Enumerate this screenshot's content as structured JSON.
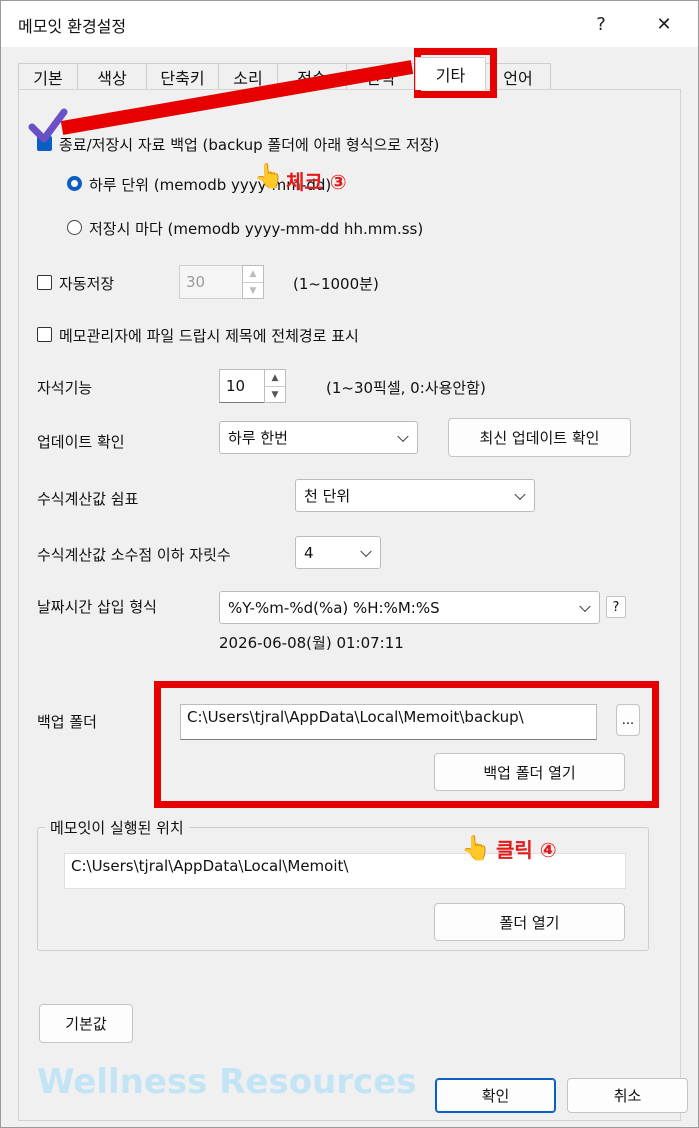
{
  "window": {
    "title": "메모잇 환경설정",
    "help_label": "?",
    "close_label": "✕"
  },
  "tabs": [
    "기본",
    "색상",
    "단축키",
    "소리",
    "전송",
    "단락",
    "기타",
    "언어"
  ],
  "active_tab": "기타",
  "backup": {
    "checkbox_label": "종료/저장시 자료 백업 (backup 폴더에 아래 형식으로 저장)",
    "checked": true,
    "option_daily": "하루 단위   (memodb yyyy-mm-dd)",
    "option_each": "저장시 마다 (memodb yyyy-mm-dd hh.mm.ss)",
    "selected": "daily"
  },
  "autosave": {
    "label": "자동저장",
    "value": "30",
    "range": "(1~1000분)"
  },
  "fullpath": {
    "label": "메모관리자에 파일 드랍시 제목에 전체경로 표시"
  },
  "magnet": {
    "label": "자석기능",
    "value": "10",
    "range": "(1~30픽셀, 0:사용안함)"
  },
  "update": {
    "label": "업데이트 확인",
    "value": "하루 한번",
    "check_button": "최신 업데이트 확인"
  },
  "formula_sep": {
    "label": "수식계산값 쉼표",
    "value": "천 단위"
  },
  "formula_dec": {
    "label": "수식계산값 소수점 이하 자릿수",
    "value": "4"
  },
  "datetime": {
    "label": "날짜시간 삽입 형식",
    "value": "%Y-%m-%d(%a) %H:%M:%S",
    "help": "?",
    "preview": "2026-06-08(월) 01:07:11"
  },
  "backup_folder": {
    "label": "백업 폴더",
    "path": "C:\\Users\\tjral\\AppData\\Local\\Memoit\\backup\\",
    "browse": "...",
    "open_button": "백업 폴더 열기"
  },
  "run_location": {
    "group_title": "메모잇이 실행된 위치",
    "path": "C:\\Users\\tjral\\AppData\\Local\\Memoit\\",
    "open_button": "폴더 열기"
  },
  "defaults_button": "기본값",
  "ok_button": "확인",
  "cancel_button": "취소",
  "annotations": {
    "check": "체크 ③",
    "click": "클릭 ④",
    "accent_color": "#e60000"
  },
  "watermark": "Wellness Resources"
}
